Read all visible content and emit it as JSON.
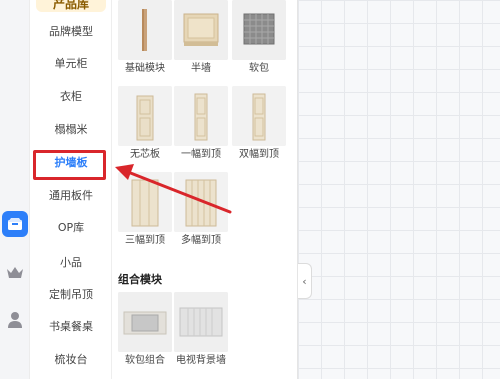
{
  "sidebar": {
    "header": "产品库",
    "items": [
      {
        "label": "品牌模型"
      },
      {
        "label": "单元柜"
      },
      {
        "label": "衣柜"
      },
      {
        "label": "榻榻米"
      },
      {
        "label": "护墙板",
        "active": true
      },
      {
        "label": "通用板件"
      },
      {
        "label": "OP库"
      },
      {
        "label": "小品"
      },
      {
        "label": "定制吊顶"
      },
      {
        "label": "书桌餐桌"
      },
      {
        "label": "梳妆台"
      }
    ]
  },
  "rail": {
    "icons": [
      "box-icon",
      "crown-icon",
      "user-icon"
    ],
    "active_icon": "box-icon"
  },
  "panel": {
    "cards": [
      {
        "label": "基础模块"
      },
      {
        "label": "半墙"
      },
      {
        "label": "软包"
      },
      {
        "label": "无芯板"
      },
      {
        "label": "一幅到顶"
      },
      {
        "label": "双幅到顶"
      },
      {
        "label": "三幅到顶"
      },
      {
        "label": "多幅到顶"
      }
    ],
    "section_title": "组合模块",
    "combo_cards": [
      {
        "label": "软包组合"
      },
      {
        "label": "电视背景墙"
      }
    ]
  },
  "colors": {
    "accent": "#2d7ff9",
    "annotation": "#d9262b",
    "header_bg": "#fff3d9"
  }
}
